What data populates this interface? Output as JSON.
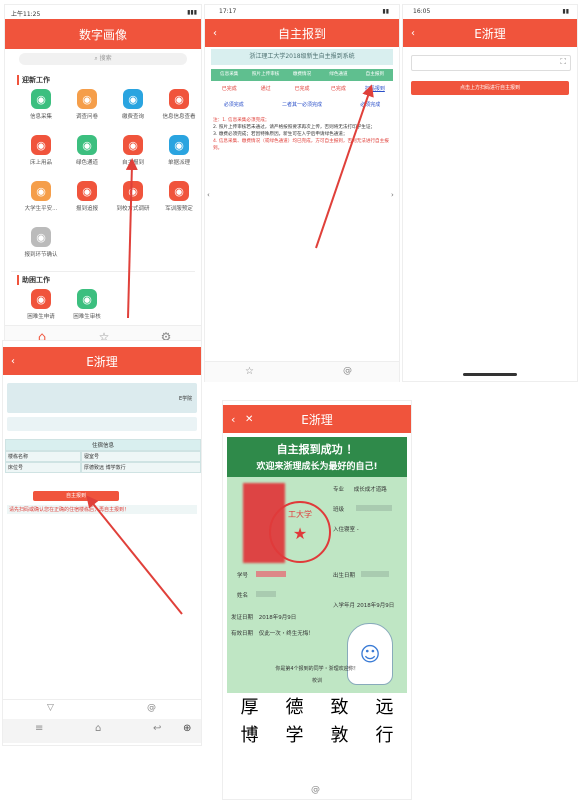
{
  "screen1": {
    "status_time": "上午11:25",
    "title": "数字画像",
    "search_placeholder": "搜索",
    "section1": "迎新工作",
    "apps": [
      {
        "label": "信息采集",
        "color": "#3cbf7f",
        "icon": "doc-icon"
      },
      {
        "label": "调查问卷",
        "color": "#f59e4a",
        "icon": "survey-icon"
      },
      {
        "label": "缴费查询",
        "color": "#2aa4e0",
        "icon": "bag-icon"
      },
      {
        "label": "信息信息查看",
        "color": "#f0543c",
        "icon": "circle-icon"
      },
      {
        "label": "床上用品",
        "color": "#f0543c",
        "icon": "bed-icon"
      },
      {
        "label": "绿色通道",
        "color": "#3cbf7f",
        "icon": "green-channel-icon"
      },
      {
        "label": "自主报到",
        "color": "#f0543c",
        "icon": "checkin-icon"
      },
      {
        "label": "单据派理",
        "color": "#2aa4e0",
        "icon": "doc-icon"
      },
      {
        "label": "大学生平安...",
        "color": "#f59e4a",
        "icon": "shield-icon"
      },
      {
        "label": "报到追报",
        "color": "#f0543c",
        "icon": "report-icon"
      },
      {
        "label": "到校方式调研",
        "color": "#f0543c",
        "icon": "bus-icon"
      },
      {
        "label": "军训服预定",
        "color": "#f0543c",
        "icon": "uniform-icon"
      },
      {
        "label": "报到环节确认",
        "color": "#bbbbbb",
        "icon": "confirm-icon"
      }
    ],
    "section2": "助困工作",
    "apps2": [
      {
        "label": "困难生申请",
        "color": "#f0543c",
        "icon": "apply-icon"
      },
      {
        "label": "困难生审核",
        "color": "#3cbf7f",
        "icon": "review-icon"
      }
    ],
    "tabs": [
      "启程",
      "常用",
      "设置"
    ]
  },
  "screen2": {
    "status_time": "17:17",
    "title": "自主报到",
    "banner": "浙江理工大学2018级新生自主报到系统",
    "step_tabs": [
      "信息采集",
      "照片上传审核",
      "缴费情况",
      "绿色通道",
      "自主报到"
    ],
    "status_row1": [
      "已完成",
      "通过",
      "已完成",
      "已完成",
      "扫码报到"
    ],
    "status_row2": [
      "必须完成",
      "二者其一必须完成",
      "必须完成"
    ],
    "notes_title": "注：1. 信息采集必须完成；",
    "notes": [
      "2. 照片上传审核若未通过，请严格按照要求再次上传，否则将无法打印学生证；",
      "3. 缴费必须完成；若因特殊原因，新生可在入学后申请绿色通道；",
      "4. 信息采集、缴费情况（或绿色通道）均已完成，方可自主报到，否则无法进行自主报到。"
    ]
  },
  "screen3": {
    "status_time": "16:05",
    "title": "E浙理",
    "scan_button": "点击上方扫码进行自主报到"
  },
  "screen4": {
    "title": "E浙理",
    "side_text": "E学院",
    "table_title": "住宿信息",
    "rows": [
      [
        "楼栋名称",
        "寝室号"
      ],
      [
        "床位号",
        "厚德致远 博学敦行"
      ]
    ],
    "confirm_button": "自主报到",
    "tip": "请先扫码或确认您在正确的住宿楼栋后，再自主报到！"
  },
  "screen5": {
    "title": "E浙理",
    "headline1": "自主报到成功 ！",
    "headline2": "欢迎来浙理成长为最好的自己!",
    "fields": {
      "major_label": "专业",
      "major_value": "成长成才道路",
      "class_label": "班级",
      "dorm_label": "入住寝室 -",
      "student_no_label": "学号",
      "name_label": "姓名",
      "birth_label": "出生日期",
      "enroll_label": "入学年月",
      "enroll_value": "2018年9月9日",
      "issue_label": "发证日期",
      "issue_value": "2018年9月9日",
      "valid_label": "有效日期",
      "valid_value": "仅此一次・终生无悔！"
    },
    "seal_text": "工大学",
    "footer_note": "你是第4个报到的同学・浙理欢迎你！",
    "footer_sub": "校训",
    "motto_line1": [
      "厚",
      "德",
      "致",
      "远"
    ],
    "motto_line2": [
      "博",
      "学",
      "敦",
      "行"
    ]
  },
  "colors": {
    "accent": "#f0543c",
    "teal_banner": "#d9efef",
    "green_bg": "#bfe6c4",
    "step_green": "#5fbf8f"
  }
}
